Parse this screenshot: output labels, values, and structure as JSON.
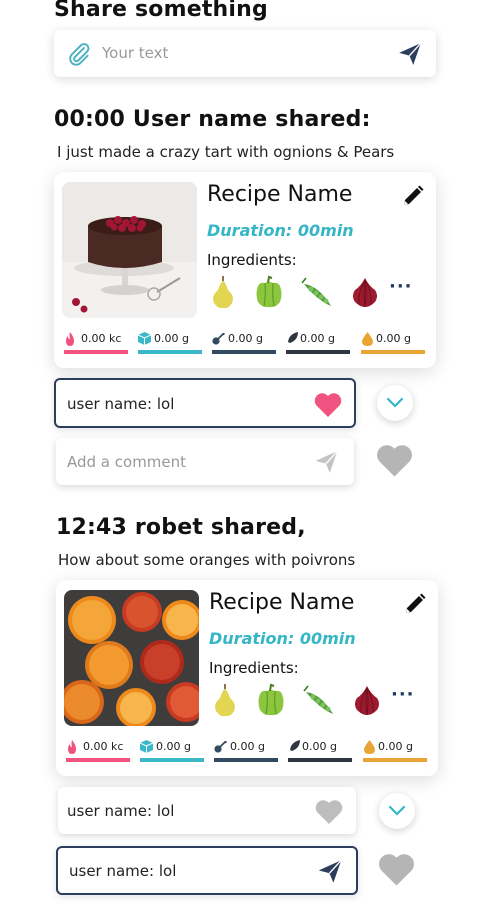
{
  "share": {
    "heading": "Share something",
    "placeholder": "Your text"
  },
  "posts": [
    {
      "header": "00:00 User name shared:",
      "message": "I just made a crazy tart with ognions & Pears",
      "recipe": {
        "name": "Recipe Name",
        "duration": "Duration: 00min",
        "ingredients_label": "Ingredients:",
        "ingredients": [
          "pear-icon",
          "pepper-icon",
          "peas-icon",
          "onion-icon"
        ],
        "more": "···",
        "nutrition": [
          {
            "icon": "flame-icon",
            "value": "0.00 kc",
            "color": "#f0537f"
          },
          {
            "icon": "cube-icon",
            "value": "0.00 g",
            "color": "#3ab8c8"
          },
          {
            "icon": "drumstick-icon",
            "value": "0.00 g",
            "color": "#344a63"
          },
          {
            "icon": "leaf-icon",
            "value": "0.00 g",
            "color": "#2f3640"
          },
          {
            "icon": "drop-icon",
            "value": "0.00 g",
            "color": "#e8a534"
          }
        ]
      },
      "comment_user": "user name: lol",
      "comment_liked": true,
      "add_comment_placeholder": "Add a comment"
    },
    {
      "header": "12:43 robet shared,",
      "message": "How about some oranges with poivrons",
      "recipe": {
        "name": "Recipe Name",
        "duration": "Duration: 00min",
        "ingredients_label": "Ingredients:",
        "ingredients": [
          "pear-icon",
          "pepper-icon",
          "peas-icon",
          "onion-icon"
        ],
        "more": "···",
        "nutrition": [
          {
            "icon": "flame-icon",
            "value": "0.00 kc",
            "color": "#f0537f"
          },
          {
            "icon": "cube-icon",
            "value": "0.00 g",
            "color": "#3ab8c8"
          },
          {
            "icon": "drumstick-icon",
            "value": "0.00 g",
            "color": "#344a63"
          },
          {
            "icon": "leaf-icon",
            "value": "0.00 g",
            "color": "#2f3640"
          },
          {
            "icon": "drop-icon",
            "value": "0.00 g",
            "color": "#e8a534"
          }
        ]
      },
      "comment_user": "user name: lol",
      "comment_liked": false,
      "reply_text": "user name: lol"
    }
  ],
  "colors": {
    "accent_teal": "#35b6c6",
    "heart_pink": "#f0537f",
    "navy": "#2b3e5c",
    "heart_gray": "#b5b5b5"
  }
}
